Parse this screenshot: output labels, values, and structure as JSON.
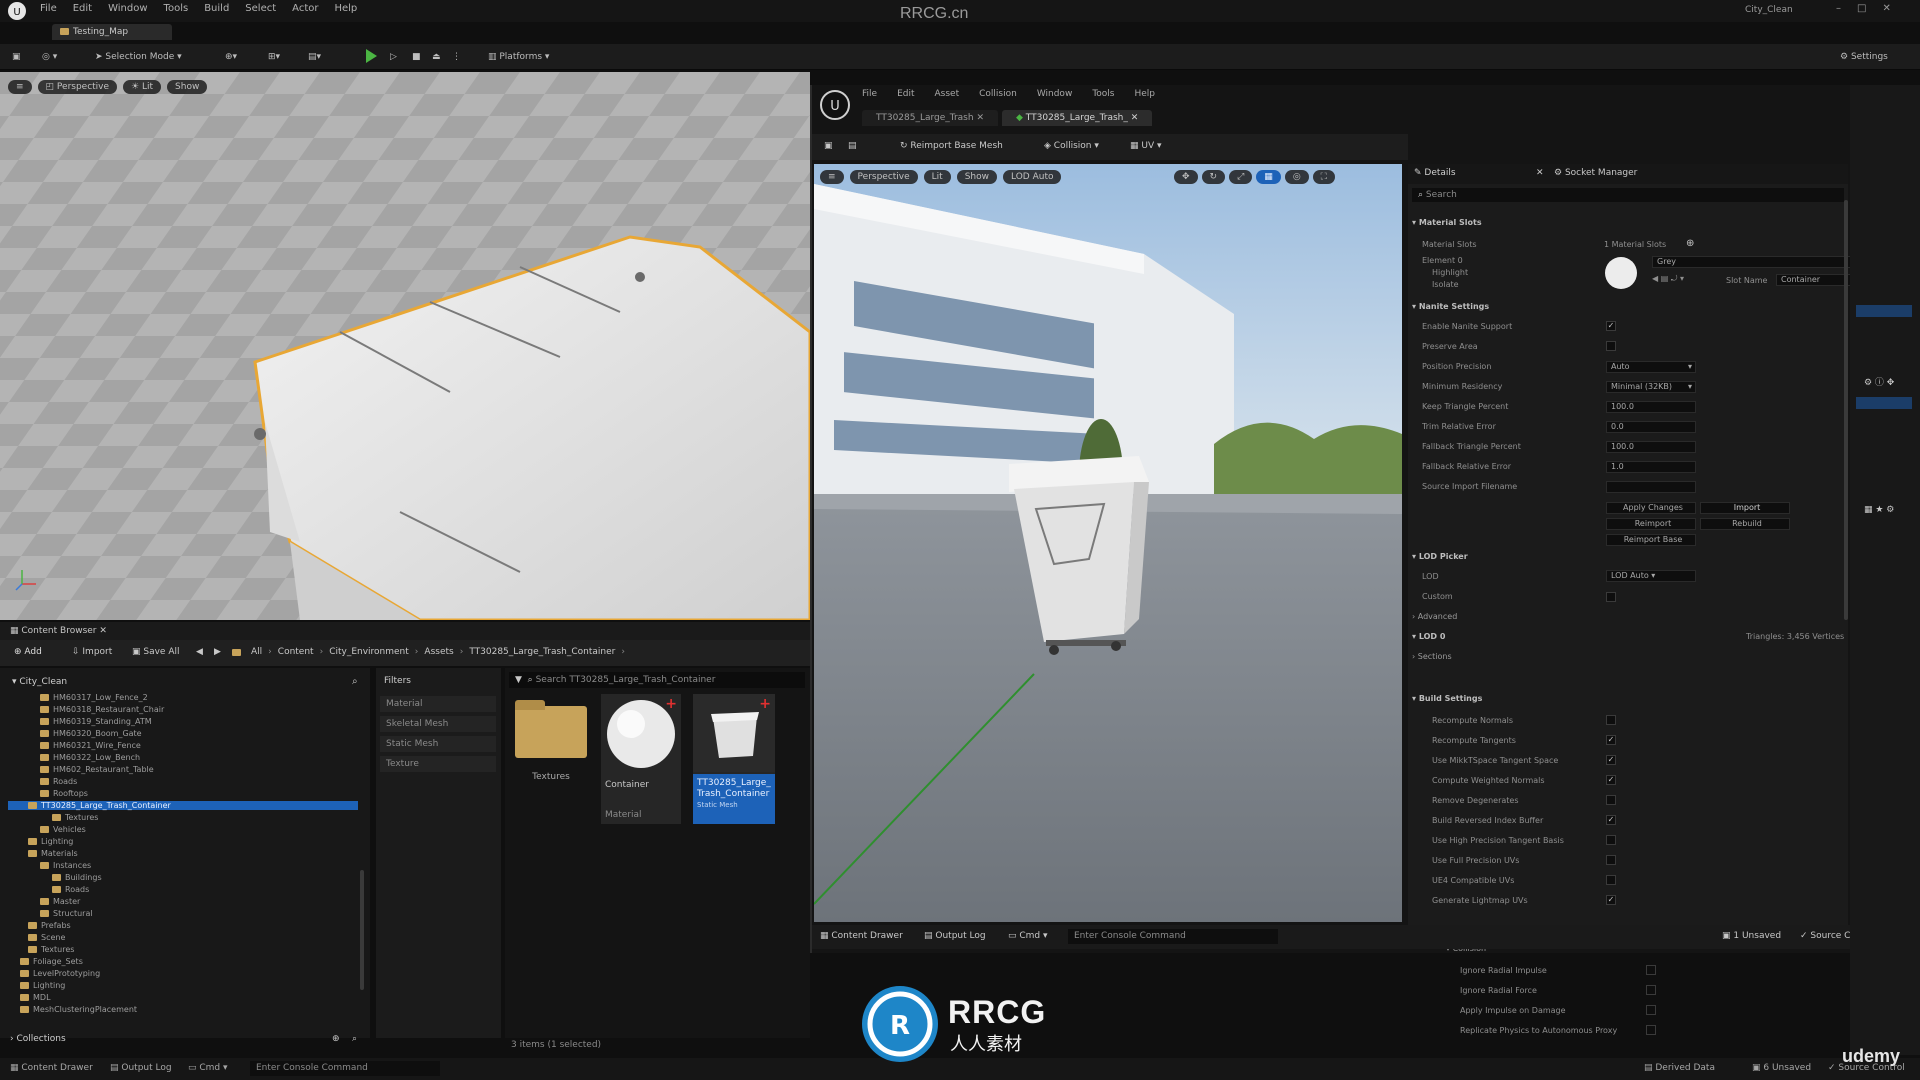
{
  "titlebar": {
    "menu": [
      "File",
      "Edit",
      "Window",
      "Tools",
      "Build",
      "Select",
      "Actor",
      "Help"
    ],
    "watermark": "RRCG.cn",
    "project": "City_Clean",
    "level_tab": "Testing_Map"
  },
  "toolbar": {
    "selection_mode": "Selection Mode",
    "platforms": "Platforms",
    "settings": "Settings"
  },
  "viewport_left": {
    "perspective": "Perspective",
    "lit": "Lit",
    "show": "Show"
  },
  "content_browser": {
    "tab": "Content Browser",
    "add": "Add",
    "import": "Import",
    "save_all": "Save All",
    "breadcrumb": [
      "All",
      "Content",
      "City_Environment",
      "Assets",
      "TT30285_Large_Trash_Container"
    ],
    "search_placeholder": "Search TT30285_Large_Trash_Container",
    "root": "City_Clean",
    "tree": [
      "HM60317_Low_Fence_2",
      "HM60318_Restaurant_Chair",
      "HM60319_Standing_ATM",
      "HM60320_Boom_Gate",
      "HM60321_Wire_Fence",
      "HM60322_Low_Bench",
      "HM602_Restaurant_Table",
      "Roads",
      "Rooftops",
      "TT30285_Large_Trash_Container",
      "Textures",
      "Vehicles",
      "Lighting",
      "Materials",
      "Instances",
      "Buildings",
      "Roads",
      "Master",
      "Structural",
      "Prefabs",
      "Scene",
      "Textures",
      "Foliage_Sets",
      "LevelPrototyping",
      "Lighting",
      "MDL",
      "MeshClusteringPlacement"
    ],
    "collections": "Collections",
    "filters_title": "Filters",
    "filters": [
      "Material",
      "Skeletal Mesh",
      "Static Mesh",
      "Texture"
    ],
    "assets": [
      {
        "name": "Textures",
        "type": "folder"
      },
      {
        "name": "Container",
        "type": "material",
        "sub": "Material"
      },
      {
        "name": "TT30285_Large_Trash_Container",
        "type": "mesh",
        "sub": "Static Mesh"
      }
    ],
    "item_count": "3 items (1 selected)"
  },
  "asset_editor": {
    "menu": [
      "File",
      "Edit",
      "Asset",
      "Collision",
      "Window",
      "Tools",
      "Help"
    ],
    "tabs": [
      "TT30285_Large_Trash",
      "TT30285_Large_Trash_"
    ],
    "toolbar": [
      "Reimport Base Mesh",
      "Collision",
      "UV"
    ],
    "viewport_buttons": [
      "Perspective",
      "Lit",
      "Show",
      "LOD Auto"
    ],
    "details_tab": "Details",
    "socket_tab": "Socket Manager",
    "search_placeholder": "Search",
    "sections": {
      "material_slots": "Material Slots",
      "nanite_settings": "Nanite Settings",
      "lod_picker": "LOD Picker",
      "lod0": "LOD 0",
      "sections": "Sections",
      "build_settings": "Build Settings",
      "advanced": "Advanced",
      "collision": "Collision"
    },
    "material_slots": {
      "label": "Material Slots",
      "element": "Element 0",
      "count": "1 Material Slots",
      "highlight": "Highlight",
      "isolate": "Isolate",
      "material_name": "Container",
      "slot_name_label": "Slot Name",
      "slot_name": "Container",
      "search_value": "Grey"
    },
    "nanite": [
      {
        "label": "Enable Nanite Support",
        "type": "check",
        "checked": true
      },
      {
        "label": "Preserve Area",
        "type": "check",
        "checked": false
      },
      {
        "label": "Position Precision",
        "type": "select",
        "value": "Auto"
      },
      {
        "label": "Minimum Residency",
        "type": "select",
        "value": "Minimal (32KB)"
      },
      {
        "label": "Keep Triangle Percent",
        "type": "input",
        "value": "100.0"
      },
      {
        "label": "Trim Relative Error",
        "type": "input",
        "value": "0.0"
      },
      {
        "label": "Fallback Triangle Percent",
        "type": "input",
        "value": "100.0"
      },
      {
        "label": "Fallback Relative Error",
        "type": "input",
        "value": "1.0"
      },
      {
        "label": "Source Import Filename",
        "type": "input",
        "value": ""
      }
    ],
    "nanite_buttons": [
      "Apply Changes",
      "Import",
      "Reimport",
      "Rebuild",
      "Reimport Base"
    ],
    "lod": [
      {
        "label": "LOD",
        "type": "select",
        "value": "LOD Auto"
      },
      {
        "label": "Custom",
        "type": "check",
        "checked": false
      }
    ],
    "lod0_info": "Triangles: 3,456  Vertices",
    "build_settings": [
      {
        "label": "Recompute Normals",
        "checked": false
      },
      {
        "label": "Recompute Tangents",
        "checked": true
      },
      {
        "label": "Use MikkTSpace Tangent Space",
        "checked": true
      },
      {
        "label": "Compute Weighted Normals",
        "checked": true
      },
      {
        "label": "Remove Degenerates",
        "checked": false
      },
      {
        "label": "Build Reversed Index Buffer",
        "checked": true
      },
      {
        "label": "Use High Precision Tangent Basis",
        "checked": false
      },
      {
        "label": "Use Full Precision UVs",
        "checked": false
      },
      {
        "label": "UE4 Compatible UVs",
        "checked": false
      },
      {
        "label": "Generate Lightmap UVs",
        "checked": true
      }
    ],
    "collision_props": [
      "Ignore Radial Impulse",
      "Ignore Radial Force",
      "Apply Impulse on Damage",
      "Replicate Physics to Autonomous Proxy"
    ],
    "bottom": {
      "content_drawer": "Content Drawer",
      "output_log": "Output Log",
      "cmd": "Cmd",
      "console_placeholder": "Enter Console Command",
      "unsaved": "1 Unsaved",
      "source_control": "Source Control"
    }
  },
  "status_bar": {
    "content_drawer": "Content Drawer",
    "output_log": "Output Log",
    "cmd": "Cmd",
    "console_placeholder": "Enter Console Command",
    "derived_data": "Derived Data",
    "unsaved": "6 Unsaved",
    "source_control": "Source Control"
  },
  "overlay": {
    "brand": "RRCG",
    "brand_cn": "人人素材",
    "udemy": "udemy"
  },
  "colors": {
    "accent_blue": "#1d62b8",
    "play_green": "#4bb543",
    "folder": "#c7a35a",
    "selection_outline": "#e8a735"
  }
}
